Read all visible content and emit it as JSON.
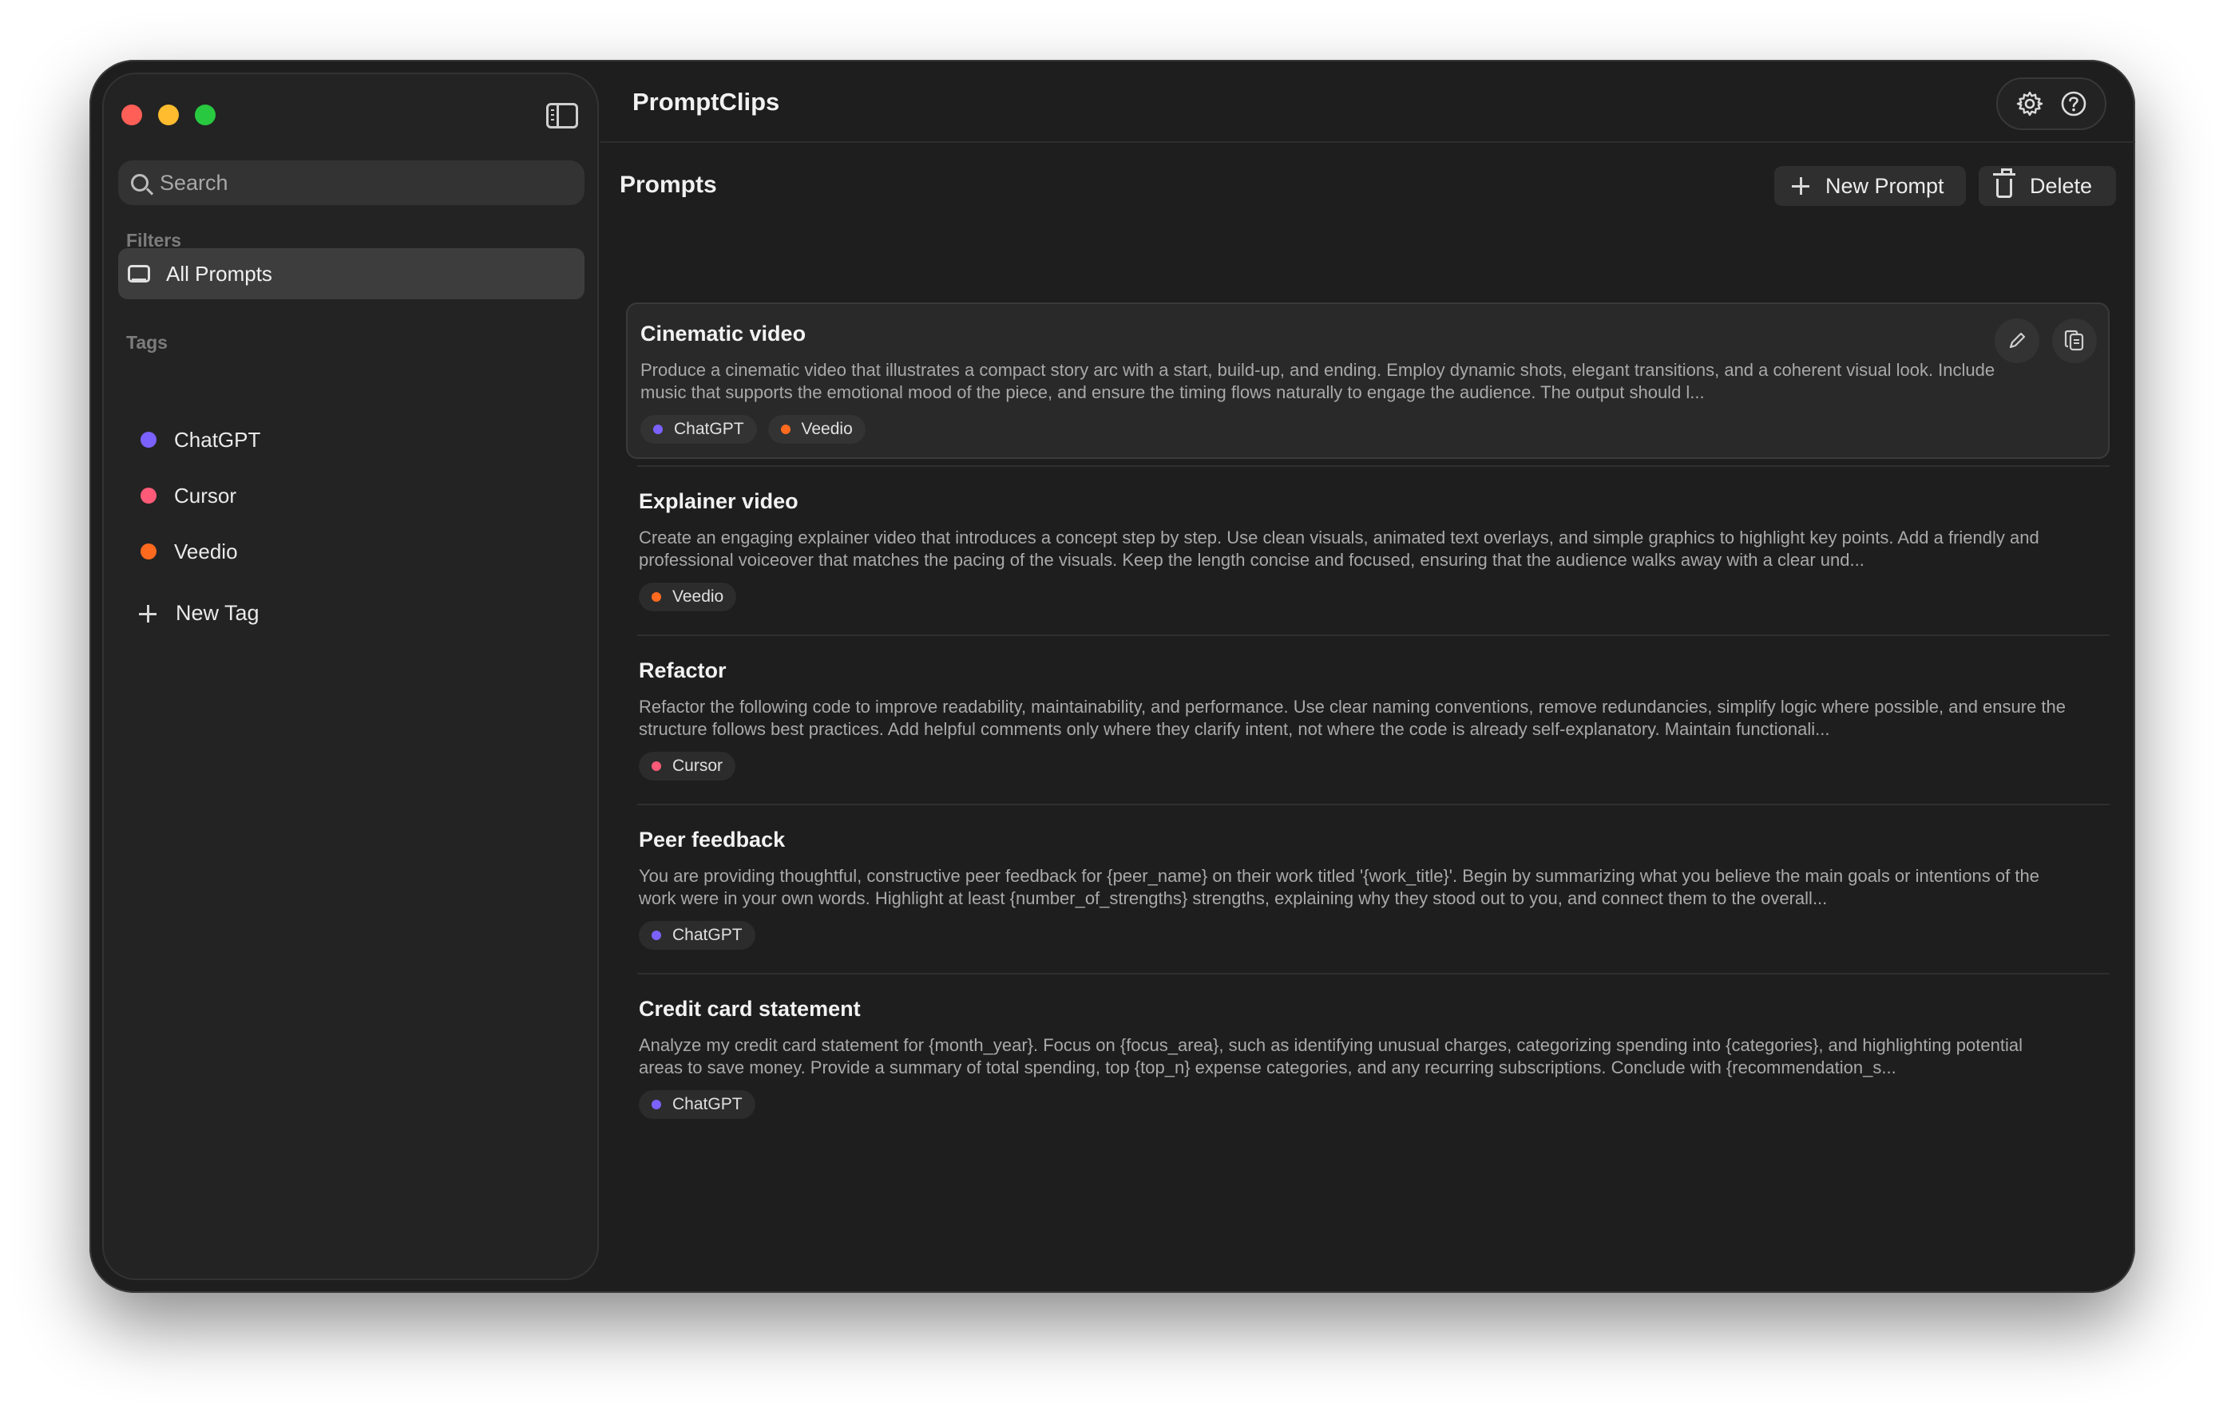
{
  "app": {
    "title": "PromptClips"
  },
  "sidebar": {
    "search_placeholder": "Search",
    "filters_label": "Filters",
    "filters": [
      {
        "label": "All Prompts",
        "selected": true,
        "icon": "tray-icon"
      }
    ],
    "tags_label": "Tags",
    "tags": [
      {
        "name": "ChatGPT",
        "color": "#7b61ff"
      },
      {
        "name": "Cursor",
        "color": "#ff5a78"
      },
      {
        "name": "Veedio",
        "color": "#ff6a1f"
      }
    ],
    "new_tag_label": "New Tag"
  },
  "toolbar": {
    "settings_icon": "gear-icon",
    "help_icon": "help-icon"
  },
  "main": {
    "title": "Prompts",
    "new_prompt_label": "New Prompt",
    "delete_label": "Delete",
    "prompts": [
      {
        "title": "Cinematic video",
        "body": "Produce a cinematic video that illustrates a compact story arc with a start, build-up, and ending. Employ dynamic shots, elegant transitions, and a coherent visual look. Include music that supports the emotional mood of the piece, and ensure the timing flows naturally to engage the audience. The output should l...",
        "tags": [
          "ChatGPT",
          "Veedio"
        ],
        "selected": true
      },
      {
        "title": "Explainer video",
        "body": "Create an engaging explainer video that introduces a concept step by step. Use clean visuals, animated text overlays, and simple graphics to highlight key points. Add a friendly and professional voiceover that matches the pacing of the visuals. Keep the length concise and focused, ensuring that the audience walks away with a clear und...",
        "tags": [
          "Veedio"
        ]
      },
      {
        "title": "Refactor",
        "body": "Refactor the following code to improve readability, maintainability, and performance. Use clear naming conventions, remove redundancies, simplify logic where possible, and ensure the structure follows best practices. Add helpful comments only where they clarify intent, not where the code is already self-explanatory. Maintain functionali...",
        "tags": [
          "Cursor"
        ]
      },
      {
        "title": "Peer feedback",
        "body": "You are providing thoughtful, constructive peer feedback for {peer_name} on their work titled '{work_title}'. Begin by summarizing what you believe the main goals or intentions of the work were in your own words. Highlight at least {number_of_strengths} strengths, explaining why they stood out to you, and connect them to the overall...",
        "tags": [
          "ChatGPT"
        ]
      },
      {
        "title": "Credit card statement",
        "body": "Analyze my credit card statement for {month_year}. Focus on {focus_area}, such as identifying unusual charges, categorizing spending into {categories}, and highlighting potential areas to save money. Provide a summary of total spending, top {top_n} expense categories, and any recurring subscriptions. Conclude with {recommendation_s...",
        "tags": [
          "ChatGPT"
        ]
      }
    ]
  }
}
